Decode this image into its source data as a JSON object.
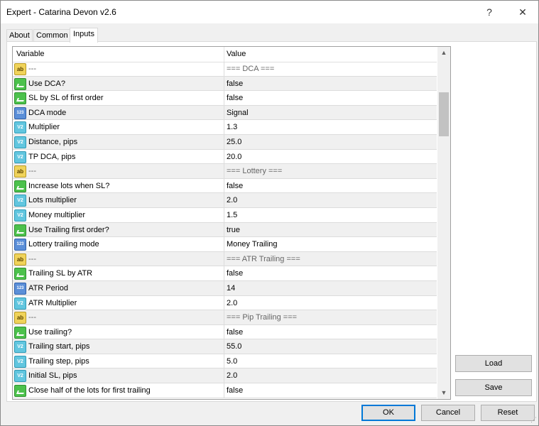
{
  "window": {
    "title": "Expert - Catarina Devon v2.6",
    "help_glyph": "?",
    "close_glyph": "✕"
  },
  "tabs": [
    {
      "label": "About"
    },
    {
      "label": "Common"
    },
    {
      "label": "Inputs",
      "active": true
    }
  ],
  "grid": {
    "col_variable": "Variable",
    "col_value": "Value",
    "rows": [
      {
        "icon": "ab",
        "variable": "---",
        "value": "=== DCA ==="
      },
      {
        "icon": "bool",
        "variable": "Use DCA?",
        "value": "false"
      },
      {
        "icon": "bool",
        "variable": "SL by SL of first order",
        "value": "false"
      },
      {
        "icon": "123",
        "variable": "DCA mode",
        "value": "Signal"
      },
      {
        "icon": "v2",
        "variable": "Multiplier",
        "value": "1.3"
      },
      {
        "icon": "v2",
        "variable": "Distance, pips",
        "value": "25.0"
      },
      {
        "icon": "v2",
        "variable": "TP DCA, pips",
        "value": "20.0"
      },
      {
        "icon": "ab",
        "variable": "---",
        "value": "=== Lottery ==="
      },
      {
        "icon": "bool",
        "variable": "Increase lots when SL?",
        "value": "false"
      },
      {
        "icon": "v2",
        "variable": "Lots multiplier",
        "value": "2.0"
      },
      {
        "icon": "v2",
        "variable": "Money multiplier",
        "value": "1.5"
      },
      {
        "icon": "bool",
        "variable": "Use Trailing first order?",
        "value": "true"
      },
      {
        "icon": "123",
        "variable": "Lottery trailing mode",
        "value": "Money Trailing"
      },
      {
        "icon": "ab",
        "variable": "---",
        "value": "=== ATR Trailing ==="
      },
      {
        "icon": "bool",
        "variable": "Trailing SL by ATR",
        "value": "false"
      },
      {
        "icon": "123",
        "variable": "ATR Period",
        "value": "14"
      },
      {
        "icon": "v2",
        "variable": "ATR Multiplier",
        "value": "2.0"
      },
      {
        "icon": "ab",
        "variable": "---",
        "value": "=== Pip Trailing ==="
      },
      {
        "icon": "bool",
        "variable": "Use trailing?",
        "value": "false"
      },
      {
        "icon": "v2",
        "variable": "Trailing start, pips",
        "value": "55.0"
      },
      {
        "icon": "v2",
        "variable": "Trailing step, pips",
        "value": "5.0"
      },
      {
        "icon": "v2",
        "variable": "Initial SL, pips",
        "value": "2.0"
      },
      {
        "icon": "bool",
        "variable": "Close half of the lots for first trailing",
        "value": "false"
      }
    ]
  },
  "icons": {
    "ab": {
      "name": "string-type-icon",
      "glyph": "ab"
    },
    "bool": {
      "name": "boolean-type-icon",
      "glyph": ""
    },
    "123": {
      "name": "integer-type-icon",
      "glyph": "123"
    },
    "v2": {
      "name": "double-type-icon",
      "glyph": "V2"
    }
  },
  "side_buttons": {
    "load": "Load",
    "save": "Save"
  },
  "footer_buttons": {
    "ok": "OK",
    "cancel": "Cancel",
    "reset": "Reset"
  }
}
